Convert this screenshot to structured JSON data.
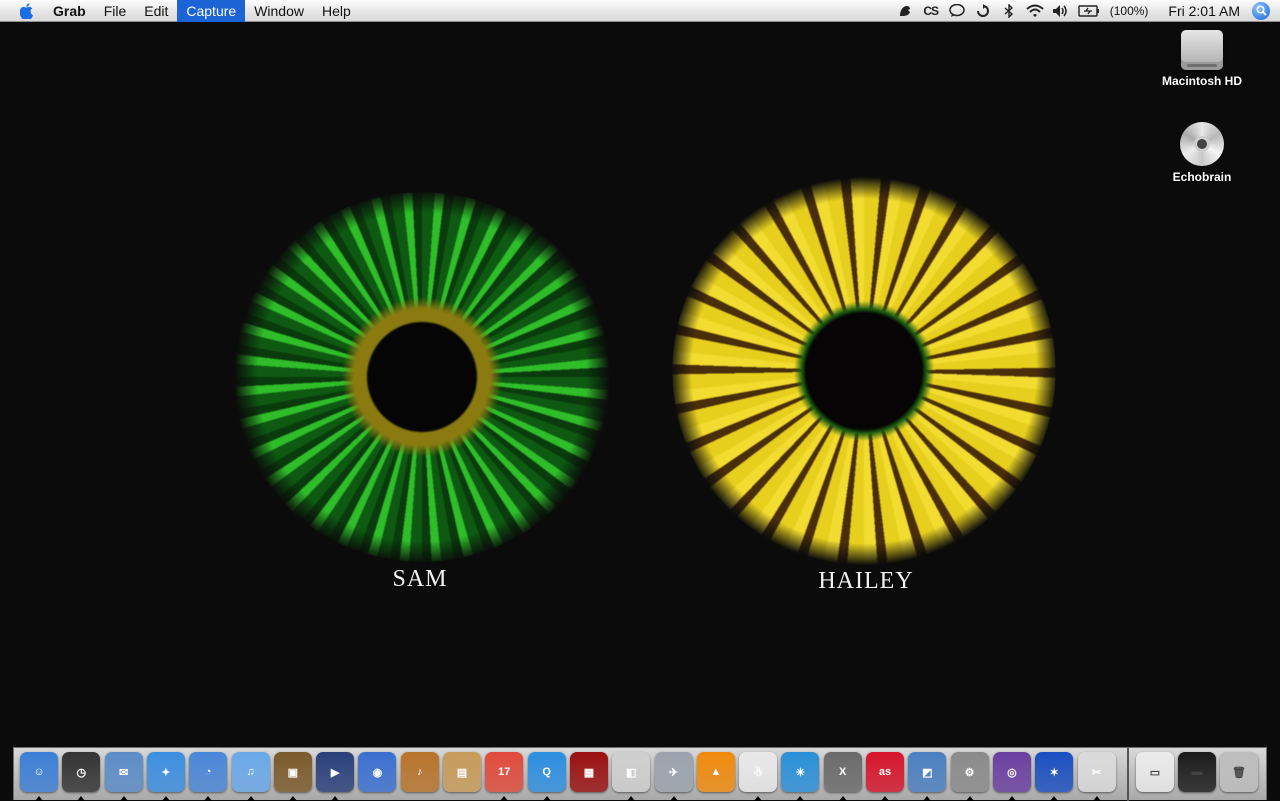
{
  "menubar": {
    "app_name": "Grab",
    "items": [
      "File",
      "Edit",
      "Capture",
      "Window",
      "Help"
    ],
    "active_item": "Capture",
    "status": {
      "cs_label": "CS",
      "battery_text": "(100%)",
      "clock": "Fri 2:01 AM"
    },
    "icons": [
      "apple-icon",
      "growl-icon",
      "cs-icon",
      "chat-bubble-icon",
      "sync-icon",
      "bluetooth-icon",
      "wifi-icon",
      "volume-icon",
      "battery-icon",
      "spotlight-icon"
    ]
  },
  "desktop": {
    "icons": [
      {
        "label": "Macintosh HD",
        "icon": "hard-drive-icon"
      },
      {
        "label": "Echobrain",
        "icon": "cd-icon"
      }
    ]
  },
  "wallpaper": {
    "left_label": "SAM",
    "right_label": "HAILEY",
    "left_iris_color": "#2fbd2a",
    "right_iris_color": "#e7cf1e"
  },
  "dock": {
    "apps": [
      {
        "name": "finder-icon",
        "glyph": "☺",
        "color": "#3b7fd6"
      },
      {
        "name": "dashboard-icon",
        "glyph": "◷",
        "color": "#333333"
      },
      {
        "name": "mail-stamp-icon",
        "glyph": "✉",
        "color": "#5c8cc8"
      },
      {
        "name": "safari-icon",
        "glyph": "✦",
        "color": "#3b8ee0"
      },
      {
        "name": "ichat-icon",
        "glyph": "◔",
        "color": "#4a86d8"
      },
      {
        "name": "itunes-icon",
        "glyph": "♫",
        "color": "#6aa8e8"
      },
      {
        "name": "iphoto-icon",
        "glyph": "▣",
        "color": "#7a5a2a"
      },
      {
        "name": "imovie-icon",
        "glyph": "▶",
        "color": "#2a3f7a"
      },
      {
        "name": "idvd-icon",
        "glyph": "◉",
        "color": "#3a6fd0"
      },
      {
        "name": "garageband-icon",
        "glyph": "♪",
        "color": "#b8732a"
      },
      {
        "name": "iweb-icon",
        "glyph": "▤",
        "color": "#c79b5a"
      },
      {
        "name": "ical-icon",
        "glyph": "17",
        "color": "#e04a3a"
      },
      {
        "name": "quicktime-icon",
        "glyph": "Q",
        "color": "#2d8ee0"
      },
      {
        "name": "front-row-icon",
        "glyph": "▦",
        "color": "#9a1010"
      },
      {
        "name": "boot-camp-icon",
        "glyph": "◧",
        "color": "#cfcfcf"
      },
      {
        "name": "migration-icon",
        "glyph": "✈",
        "color": "#9aa3ad"
      },
      {
        "name": "vlc-icon",
        "glyph": "▲",
        "color": "#f08a0c"
      },
      {
        "name": "sxs-icon",
        "glyph": "☃",
        "color": "#e8e8e8"
      },
      {
        "name": "xcode-icon",
        "glyph": "✳",
        "color": "#2a8fd8"
      },
      {
        "name": "chat-x-icon",
        "glyph": "X",
        "color": "#6a6a6a"
      },
      {
        "name": "lastfm-icon",
        "glyph": "as",
        "color": "#d6142a"
      },
      {
        "name": "preview-icon",
        "glyph": "◩",
        "color": "#4a7fc0"
      },
      {
        "name": "automator-icon",
        "glyph": "⚙",
        "color": "#8a8a8a"
      },
      {
        "name": "adium-icon",
        "glyph": "◎",
        "color": "#6a3fa0"
      },
      {
        "name": "frog-icon",
        "glyph": "✶",
        "color": "#1a4fc0"
      },
      {
        "name": "grab-icon",
        "glyph": "✂",
        "color": "#dadada"
      }
    ],
    "right": [
      {
        "name": "minimized-window-icon",
        "glyph": "▭",
        "color": "#eaeaea"
      },
      {
        "name": "terminal-window-icon",
        "glyph": "▬",
        "color": "#1a1a1a"
      },
      {
        "name": "trash-icon",
        "glyph": "🗑",
        "color": "#bdbdbd"
      }
    ]
  }
}
